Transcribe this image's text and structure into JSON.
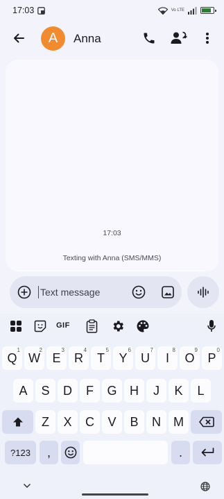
{
  "status_bar": {
    "time": "17:03",
    "network": "Vo LTE",
    "battery": "72"
  },
  "header": {
    "avatar_letter": "A",
    "contact_name": "Anna"
  },
  "conversation": {
    "timestamp": "17:03",
    "info": "Texting with Anna (SMS/MMS)"
  },
  "compose": {
    "placeholder": "Text message"
  },
  "keyboard": {
    "toolbar": {
      "gif_label": "GIF"
    },
    "row1": [
      {
        "key": "Q",
        "hint": "1"
      },
      {
        "key": "W",
        "hint": "2"
      },
      {
        "key": "E",
        "hint": "3"
      },
      {
        "key": "R",
        "hint": "4"
      },
      {
        "key": "T",
        "hint": "5"
      },
      {
        "key": "Y",
        "hint": "6"
      },
      {
        "key": "U",
        "hint": "7"
      },
      {
        "key": "I",
        "hint": "8"
      },
      {
        "key": "O",
        "hint": "9"
      },
      {
        "key": "P",
        "hint": "0"
      }
    ],
    "row2": [
      "A",
      "S",
      "D",
      "F",
      "G",
      "H",
      "J",
      "K",
      "L"
    ],
    "row3": [
      "Z",
      "X",
      "C",
      "V",
      "B",
      "N",
      "M"
    ],
    "row4": {
      "symbols": "?123",
      "comma": ",",
      "period": "."
    }
  }
}
